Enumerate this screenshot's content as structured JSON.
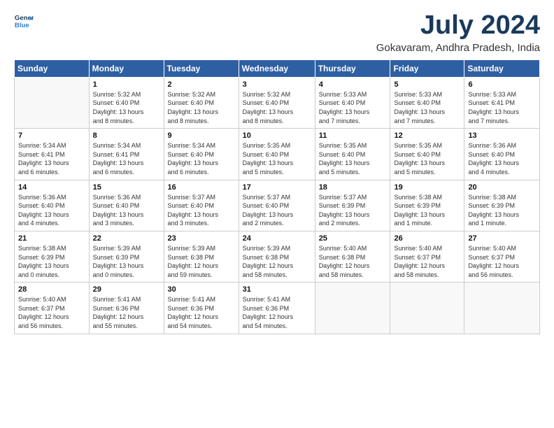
{
  "logo": {
    "line1": "General",
    "line2": "Blue"
  },
  "title": "July 2024",
  "location": "Gokavaram, Andhra Pradesh, India",
  "weekdays": [
    "Sunday",
    "Monday",
    "Tuesday",
    "Wednesday",
    "Thursday",
    "Friday",
    "Saturday"
  ],
  "weeks": [
    [
      {
        "day": "",
        "info": ""
      },
      {
        "day": "1",
        "info": "Sunrise: 5:32 AM\nSunset: 6:40 PM\nDaylight: 13 hours\nand 8 minutes."
      },
      {
        "day": "2",
        "info": "Sunrise: 5:32 AM\nSunset: 6:40 PM\nDaylight: 13 hours\nand 8 minutes."
      },
      {
        "day": "3",
        "info": "Sunrise: 5:32 AM\nSunset: 6:40 PM\nDaylight: 13 hours\nand 8 minutes."
      },
      {
        "day": "4",
        "info": "Sunrise: 5:33 AM\nSunset: 6:40 PM\nDaylight: 13 hours\nand 7 minutes."
      },
      {
        "day": "5",
        "info": "Sunrise: 5:33 AM\nSunset: 6:40 PM\nDaylight: 13 hours\nand 7 minutes."
      },
      {
        "day": "6",
        "info": "Sunrise: 5:33 AM\nSunset: 6:41 PM\nDaylight: 13 hours\nand 7 minutes."
      }
    ],
    [
      {
        "day": "7",
        "info": "Sunrise: 5:34 AM\nSunset: 6:41 PM\nDaylight: 13 hours\nand 6 minutes."
      },
      {
        "day": "8",
        "info": "Sunrise: 5:34 AM\nSunset: 6:41 PM\nDaylight: 13 hours\nand 6 minutes."
      },
      {
        "day": "9",
        "info": "Sunrise: 5:34 AM\nSunset: 6:40 PM\nDaylight: 13 hours\nand 6 minutes."
      },
      {
        "day": "10",
        "info": "Sunrise: 5:35 AM\nSunset: 6:40 PM\nDaylight: 13 hours\nand 5 minutes."
      },
      {
        "day": "11",
        "info": "Sunrise: 5:35 AM\nSunset: 6:40 PM\nDaylight: 13 hours\nand 5 minutes."
      },
      {
        "day": "12",
        "info": "Sunrise: 5:35 AM\nSunset: 6:40 PM\nDaylight: 13 hours\nand 5 minutes."
      },
      {
        "day": "13",
        "info": "Sunrise: 5:36 AM\nSunset: 6:40 PM\nDaylight: 13 hours\nand 4 minutes."
      }
    ],
    [
      {
        "day": "14",
        "info": "Sunrise: 5:36 AM\nSunset: 6:40 PM\nDaylight: 13 hours\nand 4 minutes."
      },
      {
        "day": "15",
        "info": "Sunrise: 5:36 AM\nSunset: 6:40 PM\nDaylight: 13 hours\nand 3 minutes."
      },
      {
        "day": "16",
        "info": "Sunrise: 5:37 AM\nSunset: 6:40 PM\nDaylight: 13 hours\nand 3 minutes."
      },
      {
        "day": "17",
        "info": "Sunrise: 5:37 AM\nSunset: 6:40 PM\nDaylight: 13 hours\nand 2 minutes."
      },
      {
        "day": "18",
        "info": "Sunrise: 5:37 AM\nSunset: 6:39 PM\nDaylight: 13 hours\nand 2 minutes."
      },
      {
        "day": "19",
        "info": "Sunrise: 5:38 AM\nSunset: 6:39 PM\nDaylight: 13 hours\nand 1 minute."
      },
      {
        "day": "20",
        "info": "Sunrise: 5:38 AM\nSunset: 6:39 PM\nDaylight: 13 hours\nand 1 minute."
      }
    ],
    [
      {
        "day": "21",
        "info": "Sunrise: 5:38 AM\nSunset: 6:39 PM\nDaylight: 13 hours\nand 0 minutes."
      },
      {
        "day": "22",
        "info": "Sunrise: 5:39 AM\nSunset: 6:39 PM\nDaylight: 13 hours\nand 0 minutes."
      },
      {
        "day": "23",
        "info": "Sunrise: 5:39 AM\nSunset: 6:38 PM\nDaylight: 12 hours\nand 59 minutes."
      },
      {
        "day": "24",
        "info": "Sunrise: 5:39 AM\nSunset: 6:38 PM\nDaylight: 12 hours\nand 58 minutes."
      },
      {
        "day": "25",
        "info": "Sunrise: 5:40 AM\nSunset: 6:38 PM\nDaylight: 12 hours\nand 58 minutes."
      },
      {
        "day": "26",
        "info": "Sunrise: 5:40 AM\nSunset: 6:37 PM\nDaylight: 12 hours\nand 58 minutes."
      },
      {
        "day": "27",
        "info": "Sunrise: 5:40 AM\nSunset: 6:37 PM\nDaylight: 12 hours\nand 56 minutes."
      }
    ],
    [
      {
        "day": "28",
        "info": "Sunrise: 5:40 AM\nSunset: 6:37 PM\nDaylight: 12 hours\nand 56 minutes."
      },
      {
        "day": "29",
        "info": "Sunrise: 5:41 AM\nSunset: 6:36 PM\nDaylight: 12 hours\nand 55 minutes."
      },
      {
        "day": "30",
        "info": "Sunrise: 5:41 AM\nSunset: 6:36 PM\nDaylight: 12 hours\nand 54 minutes."
      },
      {
        "day": "31",
        "info": "Sunrise: 5:41 AM\nSunset: 6:36 PM\nDaylight: 12 hours\nand 54 minutes."
      },
      {
        "day": "",
        "info": ""
      },
      {
        "day": "",
        "info": ""
      },
      {
        "day": "",
        "info": ""
      }
    ]
  ]
}
